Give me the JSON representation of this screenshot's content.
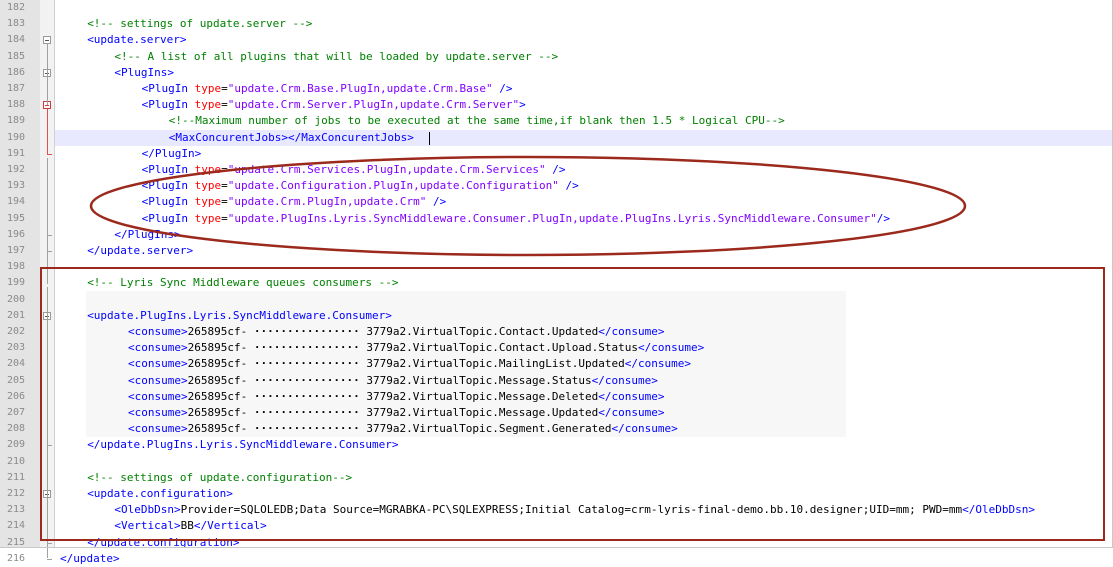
{
  "editor": {
    "lines": [
      {
        "num": "182",
        "indent": 0,
        "tokens": []
      },
      {
        "num": "183",
        "indent": 2,
        "tokens": [
          {
            "t": "cm",
            "v": "<!-- settings of update.server -->"
          }
        ]
      },
      {
        "num": "184",
        "indent": 2,
        "tokens": [
          {
            "t": "tg",
            "v": "<update.server>"
          }
        ]
      },
      {
        "num": "185",
        "indent": 4,
        "tokens": [
          {
            "t": "cm",
            "v": "<!-- A list of all plugins that will be loaded by update.server -->"
          }
        ]
      },
      {
        "num": "186",
        "indent": 4,
        "tokens": [
          {
            "t": "tg",
            "v": "<PlugIns>"
          }
        ]
      },
      {
        "num": "187",
        "indent": 6,
        "tokens": [
          {
            "t": "tg",
            "v": "<PlugIn "
          },
          {
            "t": "an",
            "v": "type"
          },
          {
            "t": "tx",
            "v": "="
          },
          {
            "t": "av",
            "v": "\"update.Crm.Base.PlugIn,update.Crm.Base\""
          },
          {
            "t": "tg",
            "v": " />"
          }
        ]
      },
      {
        "num": "188",
        "indent": 6,
        "tokens": [
          {
            "t": "tg",
            "v": "<PlugIn "
          },
          {
            "t": "an",
            "v": "type"
          },
          {
            "t": "tx",
            "v": "="
          },
          {
            "t": "av",
            "v": "\"update.Crm.Server.PlugIn,update.Crm.Server\""
          },
          {
            "t": "tg",
            "v": ">"
          }
        ]
      },
      {
        "num": "189",
        "indent": 8,
        "tokens": [
          {
            "t": "cm",
            "v": "<!--Maximum number of jobs to be executed at the same time,if blank then 1.5 * Logical CPU-->"
          }
        ]
      },
      {
        "num": "190",
        "indent": 8,
        "tokens": [
          {
            "t": "tg",
            "v": "<MaxConcurentJobs></MaxConcurentJobs>"
          }
        ]
      },
      {
        "num": "191",
        "indent": 6,
        "tokens": [
          {
            "t": "tg",
            "v": "</PlugIn>"
          }
        ]
      },
      {
        "num": "192",
        "indent": 6,
        "tokens": [
          {
            "t": "tg",
            "v": "<PlugIn "
          },
          {
            "t": "an",
            "v": "type"
          },
          {
            "t": "tx",
            "v": "="
          },
          {
            "t": "av",
            "v": "\"update.Crm.Services.PlugIn,update.Crm.Services\""
          },
          {
            "t": "tg",
            "v": " />"
          }
        ]
      },
      {
        "num": "193",
        "indent": 6,
        "tokens": [
          {
            "t": "tg",
            "v": "<PlugIn "
          },
          {
            "t": "an",
            "v": "type"
          },
          {
            "t": "tx",
            "v": "="
          },
          {
            "t": "av",
            "v": "\"update.Configuration.PlugIn,update.Configuration\""
          },
          {
            "t": "tg",
            "v": " />"
          }
        ]
      },
      {
        "num": "194",
        "indent": 6,
        "tokens": [
          {
            "t": "tg",
            "v": "<PlugIn "
          },
          {
            "t": "an",
            "v": "type"
          },
          {
            "t": "tx",
            "v": "="
          },
          {
            "t": "av",
            "v": "\"update.Crm.PlugIn,update.Crm\""
          },
          {
            "t": "tg",
            "v": " />"
          }
        ]
      },
      {
        "num": "195",
        "indent": 6,
        "tokens": [
          {
            "t": "tg",
            "v": "<PlugIn "
          },
          {
            "t": "an",
            "v": "type"
          },
          {
            "t": "tx",
            "v": "="
          },
          {
            "t": "av",
            "v": "\"update.PlugIns.Lyris.SyncMiddleware.Consumer.PlugIn,update.PlugIns.Lyris.SyncMiddleware.Consumer\""
          },
          {
            "t": "tg",
            "v": "/>"
          }
        ]
      },
      {
        "num": "196",
        "indent": 4,
        "tokens": [
          {
            "t": "tg",
            "v": "</PlugIns>"
          }
        ]
      },
      {
        "num": "197",
        "indent": 2,
        "tokens": [
          {
            "t": "tg",
            "v": "</update.server>"
          }
        ]
      },
      {
        "num": "198",
        "indent": 0,
        "tokens": []
      },
      {
        "num": "199",
        "indent": 2,
        "tokens": [
          {
            "t": "cm",
            "v": "<!-- Lyris Sync Middleware queues consumers -->"
          }
        ]
      },
      {
        "num": "200",
        "indent": 0,
        "tokens": []
      },
      {
        "num": "201",
        "indent": 2,
        "tokens": [
          {
            "t": "tg",
            "v": "<update.PlugIns.Lyris.SyncMiddleware.Consumer>"
          }
        ]
      },
      {
        "num": "202",
        "indent": 5,
        "tokens": [
          {
            "t": "tg",
            "v": "<consume>"
          },
          {
            "t": "tx",
            "v": "265895cf- "
          },
          {
            "t": "dots",
            "v": "················"
          },
          {
            "t": "tx",
            "v": " 3779a2.VirtualTopic.Contact.Updated"
          },
          {
            "t": "tg",
            "v": "</consume>"
          }
        ]
      },
      {
        "num": "203",
        "indent": 5,
        "tokens": [
          {
            "t": "tg",
            "v": "<consume>"
          },
          {
            "t": "tx",
            "v": "265895cf- "
          },
          {
            "t": "dots",
            "v": "················"
          },
          {
            "t": "tx",
            "v": " 3779a2.VirtualTopic.Contact.Upload.Status"
          },
          {
            "t": "tg",
            "v": "</consume>"
          }
        ]
      },
      {
        "num": "204",
        "indent": 5,
        "tokens": [
          {
            "t": "tg",
            "v": "<consume>"
          },
          {
            "t": "tx",
            "v": "265895cf- "
          },
          {
            "t": "dots",
            "v": "················"
          },
          {
            "t": "tx",
            "v": " 3779a2.VirtualTopic.MailingList.Updated"
          },
          {
            "t": "tg",
            "v": "</consume>"
          }
        ]
      },
      {
        "num": "205",
        "indent": 5,
        "tokens": [
          {
            "t": "tg",
            "v": "<consume>"
          },
          {
            "t": "tx",
            "v": "265895cf- "
          },
          {
            "t": "dots",
            "v": "················"
          },
          {
            "t": "tx",
            "v": " 3779a2.VirtualTopic.Message.Status"
          },
          {
            "t": "tg",
            "v": "</consume>"
          }
        ]
      },
      {
        "num": "206",
        "indent": 5,
        "tokens": [
          {
            "t": "tg",
            "v": "<consume>"
          },
          {
            "t": "tx",
            "v": "265895cf- "
          },
          {
            "t": "dots",
            "v": "················"
          },
          {
            "t": "tx",
            "v": " 3779a2.VirtualTopic.Message.Deleted"
          },
          {
            "t": "tg",
            "v": "</consume>"
          }
        ]
      },
      {
        "num": "207",
        "indent": 5,
        "tokens": [
          {
            "t": "tg",
            "v": "<consume>"
          },
          {
            "t": "tx",
            "v": "265895cf- "
          },
          {
            "t": "dots",
            "v": "················"
          },
          {
            "t": "tx",
            "v": " 3779a2.VirtualTopic.Message.Updated"
          },
          {
            "t": "tg",
            "v": "</consume>"
          }
        ]
      },
      {
        "num": "208",
        "indent": 5,
        "tokens": [
          {
            "t": "tg",
            "v": "<consume>"
          },
          {
            "t": "tx",
            "v": "265895cf- "
          },
          {
            "t": "dots",
            "v": "················"
          },
          {
            "t": "tx",
            "v": " 3779a2.VirtualTopic.Segment.Generated"
          },
          {
            "t": "tg",
            "v": "</consume>"
          }
        ]
      },
      {
        "num": "209",
        "indent": 2,
        "tokens": [
          {
            "t": "tg",
            "v": "</update.PlugIns.Lyris.SyncMiddleware.Consumer>"
          }
        ]
      },
      {
        "num": "210",
        "indent": 0,
        "tokens": []
      },
      {
        "num": "211",
        "indent": 2,
        "tokens": [
          {
            "t": "cm",
            "v": "<!-- settings of update.configuration-->"
          }
        ]
      },
      {
        "num": "212",
        "indent": 2,
        "tokens": [
          {
            "t": "tg",
            "v": "<update.configuration>"
          }
        ]
      },
      {
        "num": "213",
        "indent": 4,
        "tokens": [
          {
            "t": "tg",
            "v": "<OleDbDsn>"
          },
          {
            "t": "tx",
            "v": "Provider=SQLOLEDB;Data Source=MGRABKA-PC\\SQLEXPRESS;Initial Catalog=crm-lyris-final-demo.bb.10.designer;UID=mm; PWD=mm"
          },
          {
            "t": "tg",
            "v": "</OleDbDsn>"
          }
        ]
      },
      {
        "num": "214",
        "indent": 4,
        "tokens": [
          {
            "t": "tg",
            "v": "<Vertical>"
          },
          {
            "t": "tx",
            "v": "BB"
          },
          {
            "t": "tg",
            "v": "</Vertical>"
          }
        ]
      },
      {
        "num": "215",
        "indent": 2,
        "tokens": [
          {
            "t": "tg",
            "v": "</update.configuration>"
          }
        ]
      },
      {
        "num": "216",
        "indent": 0,
        "tokens": [
          {
            "t": "tg",
            "v": "</update>"
          }
        ]
      }
    ],
    "colors": {
      "comment": "#008000",
      "tag": "#0000ff",
      "attribute_name": "#ff0000",
      "attribute_value": "#8000ff",
      "text": "#000000",
      "annotation": "#9b2a1c"
    }
  }
}
